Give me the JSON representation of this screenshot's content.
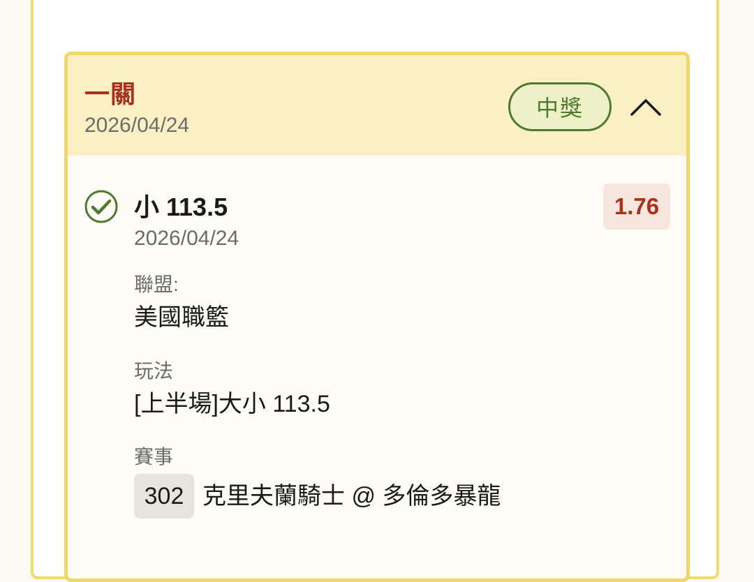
{
  "bet": {
    "type_label": "一關",
    "date": "2026/04/24",
    "status": "中獎",
    "collapse_icon": "chevron-up-icon"
  },
  "leg": {
    "result_icon": "check-circle-icon",
    "selection": "小 113.5",
    "date": "2026/04/24",
    "odds": "1.76",
    "league_label": "聯盟:",
    "league_value": "美國職籃",
    "market_label": "玩法",
    "market_value": "[上半場]大小 113.5",
    "event_label": "賽事",
    "event_code": "302",
    "event_name": "克里夫蘭騎士 @ 多倫多暴龍"
  },
  "colors": {
    "frame_border": "#f0dc6b",
    "header_bg": "#fbf0c4",
    "accent_red": "#a8311f",
    "win_green": "#4e7a2e"
  }
}
